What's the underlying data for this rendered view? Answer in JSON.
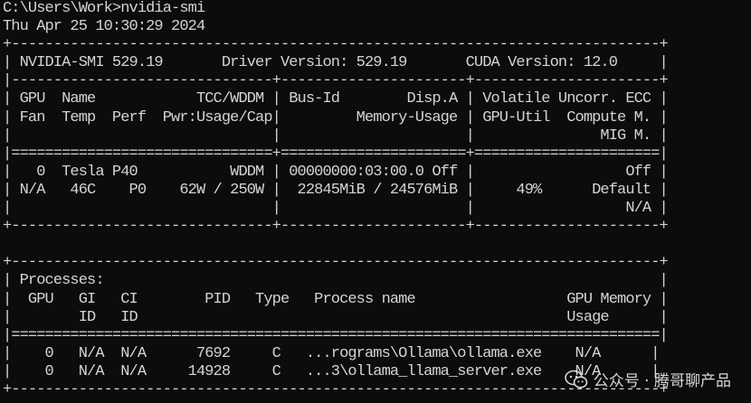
{
  "terminal": {
    "lines": [
      "C:\\Users\\Work>nvidia-smi",
      "Thu Apr 25 10:30:29 2024",
      "+-----------------------------------------------------------------------------+",
      "| NVIDIA-SMI 529.19       Driver Version: 529.19       CUDA Version: 12.0     |",
      "|-------------------------------+----------------------+----------------------+",
      "| GPU  Name            TCC/WDDM | Bus-Id        Disp.A | Volatile Uncorr. ECC |",
      "| Fan  Temp  Perf  Pwr:Usage/Cap|         Memory-Usage | GPU-Util  Compute M. |",
      "|                               |                      |               MIG M. |",
      "|===============================+======================+======================|",
      "|   0  Tesla P40           WDDM | 00000000:03:00.0 Off |                  Off |",
      "| N/A   46C    P0    62W / 250W |  22845MiB / 24576MiB |     49%      Default |",
      "|                               |                      |                  N/A |",
      "+-------------------------------+----------------------+----------------------+",
      "",
      "+-----------------------------------------------------------------------------+",
      "| Processes:                                                                  |",
      "|  GPU   GI   CI        PID   Type   Process name                  GPU Memory |",
      "|        ID   ID                                                   Usage      |",
      "|=============================================================================|",
      "|    0   N/A  N/A      7692     C   ...rograms\\Ollama\\ollama.exe    N/A      |",
      "|    0   N/A  N/A     14928     C   ...3\\ollama_llama_server.exe    N/A      |",
      "+-----------------------------------------------------------------------------+"
    ]
  },
  "watermark": {
    "icon": "wechat-icon",
    "text": "公众号 · 腾哥聊产品"
  },
  "colors": {
    "background": "#0c0c0c",
    "foreground": "#d4d4d4"
  }
}
